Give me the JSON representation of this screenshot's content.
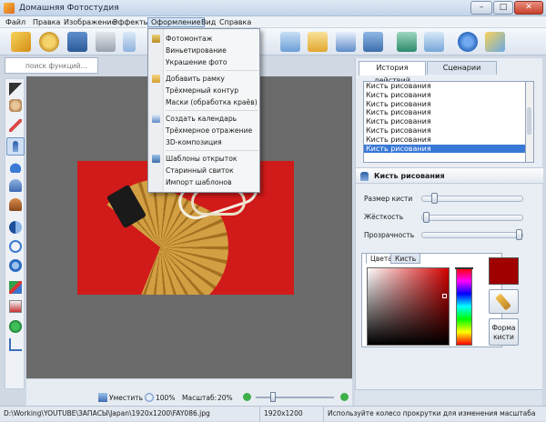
{
  "window": {
    "title": "Домашняя Фотостудия",
    "minimize": "–",
    "maximize": "□",
    "close": "✕"
  },
  "menu": {
    "items": [
      "Файл",
      "Правка",
      "Изображение",
      "Эффекты",
      "Оформление",
      "Вид",
      "Справка"
    ],
    "active": "Оформление"
  },
  "dropdown": {
    "group1": [
      "Фотомонтаж",
      "Виньетирование",
      "Украшение фото"
    ],
    "group2": [
      "Добавить рамку",
      "Трёхмерный контур",
      "Маски (обработка краёв)"
    ],
    "group3": [
      "Создать календарь",
      "Трёхмерное отражение",
      "3D-композиция"
    ],
    "group4": [
      "Шаблоны открыток",
      "Старинный свиток",
      "Импорт шаблонов"
    ]
  },
  "search": {
    "placeholder": "поиск функций..."
  },
  "right_panel": {
    "tabs": [
      "История действий",
      "Сценарии"
    ],
    "active_tab": "История действий",
    "history": [
      "Кисть рисования",
      "Кисть рисования",
      "Кисть рисования",
      "Кисть рисования",
      "Кисть рисования",
      "Кисть рисования",
      "Кисть рисования",
      "Кисть рисования"
    ],
    "selected_history_index": 7,
    "brush_title": "Кисть рисования",
    "brush_size_label": "Размер кисти",
    "hardness_label": "Жёсткость",
    "opacity_label": "Прозрачность",
    "brush_size_value": 0.1,
    "hardness_value": 0.02,
    "opacity_value": 0.99,
    "color_tabs": [
      "Цвета",
      "Кисть"
    ],
    "active_color_tab": "Цвета",
    "shape_button_label": "Форма кисти"
  },
  "zoombar": {
    "fit_label": "Уместить",
    "zoom_100_label": "100%",
    "scale_label": "Масштаб:",
    "scale_value": "20%",
    "zoom_slider_value": 0.2
  },
  "statusbar": {
    "path": "D:\\Working\\YOUTUBE\\ЗАПАСЫ\\Japan\\1920x1200\\FAY086.jpg",
    "dimensions": "1920x1200",
    "hint": "Используйте колесо прокрутки для изменения масштаба"
  },
  "colors": {
    "accent": "#3878d6",
    "current_color": "#a00000",
    "canvas_bg": "#6b6b6b",
    "photo_red": "#d11a1a"
  }
}
